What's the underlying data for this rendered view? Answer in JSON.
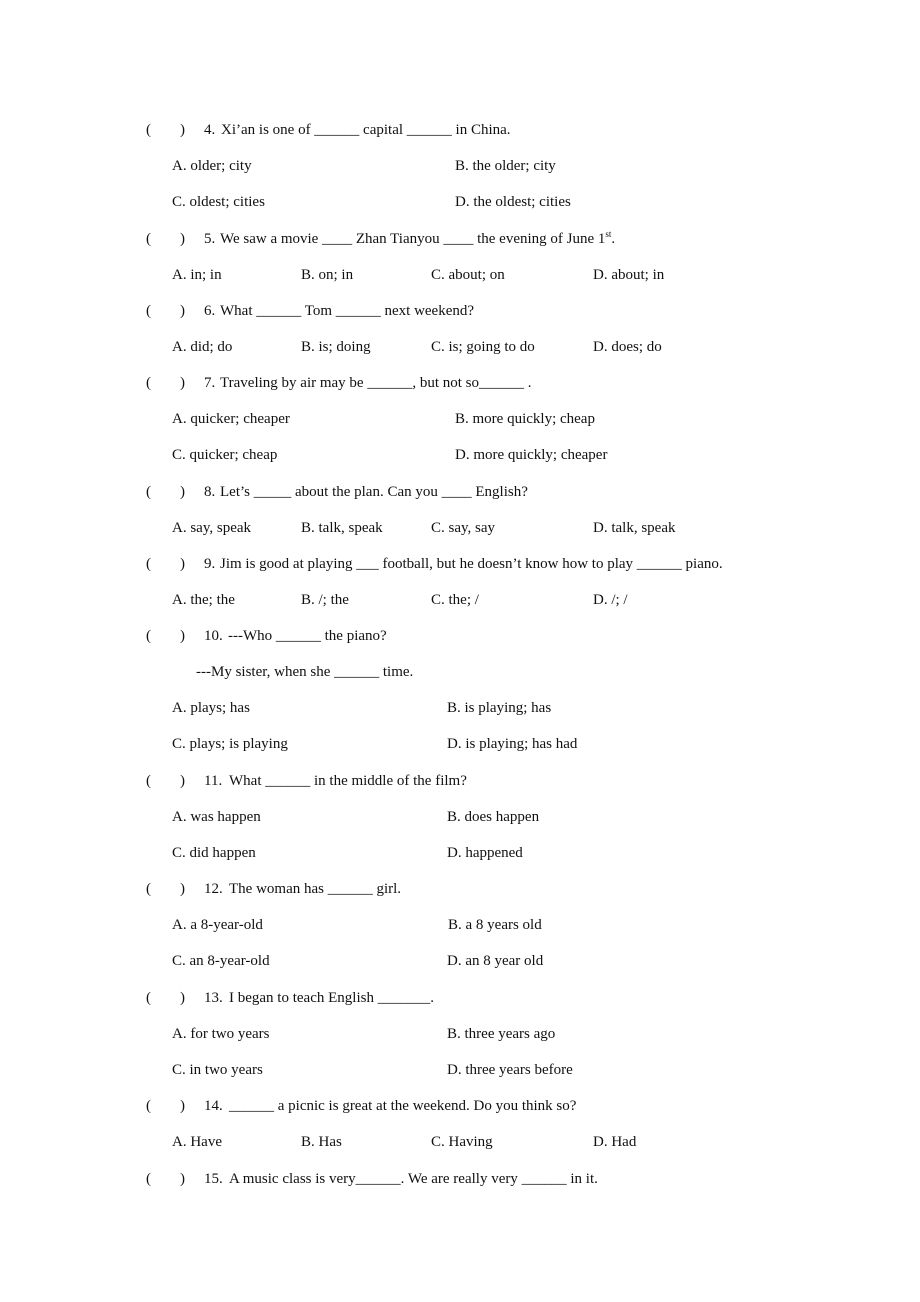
{
  "answer_blank": {
    "open": "(",
    "close": ")"
  },
  "questions": [
    {
      "number": "4.",
      "text": "Xi’an is one of ______ capital ______ in China.",
      "options": [
        "A. older; city",
        "B. the older; city",
        "C. oldest; cities",
        "D. the oldest; cities"
      ]
    },
    {
      "number": "5.",
      "text": "We saw a movie ____ Zhan Tianyou ____ the evening of June 1",
      "text_sup": "st",
      "text_end": ".",
      "options": [
        "A. in; in",
        "B. on; in",
        "C. about; on",
        "D. about; in"
      ]
    },
    {
      "number": "6.",
      "text": "What ______ Tom ______ next weekend?",
      "options": [
        "A. did; do",
        "B. is; doing",
        "C. is; going to do",
        "D. does; do"
      ]
    },
    {
      "number": "7.",
      "text": "Traveling by air may be ______, but not so______ .",
      "options": [
        "A. quicker; cheaper",
        "B. more quickly; cheap",
        "C. quicker; cheap",
        "D. more quickly; cheaper"
      ]
    },
    {
      "number": "8.",
      "text": "Let’s _____ about the plan. Can you ____ English?",
      "options": [
        "A. say, speak",
        "B. talk, speak",
        "C. say, say",
        "D. talk, speak"
      ]
    },
    {
      "number": "9.",
      "text": "Jim is good at playing ___ football, but he doesn’t know how to play ______ piano.",
      "options": [
        "A. the; the",
        "B. /; the",
        "C. the; /",
        "D. /; /"
      ]
    },
    {
      "number": "10.",
      "text": "---Who ______ the piano?",
      "text_line2": "---My sister, when she ______ time.",
      "options": [
        "A. plays; has",
        "B. is playing; has",
        "C. plays; is playing",
        "D. is playing; has had"
      ]
    },
    {
      "number": "11.",
      "text": "What ______ in the middle of the film?",
      "options": [
        "A. was happen",
        "B. does happen",
        "C. did happen",
        "D. happened"
      ]
    },
    {
      "number": "12.",
      "text": "The woman has ______ girl.",
      "options": [
        "A. a 8-year-old",
        "B. a 8 years old",
        "C. an 8-year-old",
        "D. an 8 year old"
      ]
    },
    {
      "number": "13.",
      "text": "I began to teach English _______.",
      "options": [
        "A. for two years",
        "B. three years ago",
        "C. in two years",
        "D. three years before"
      ]
    },
    {
      "number": "14.",
      "text": "______ a picnic is great at the weekend. Do you think so?",
      "options": [
        "A. Have",
        "B. Has",
        "C. Having",
        "D. Had"
      ]
    },
    {
      "number": "15.",
      "text": "A music class is very______. We are really very ______ in it."
    }
  ]
}
